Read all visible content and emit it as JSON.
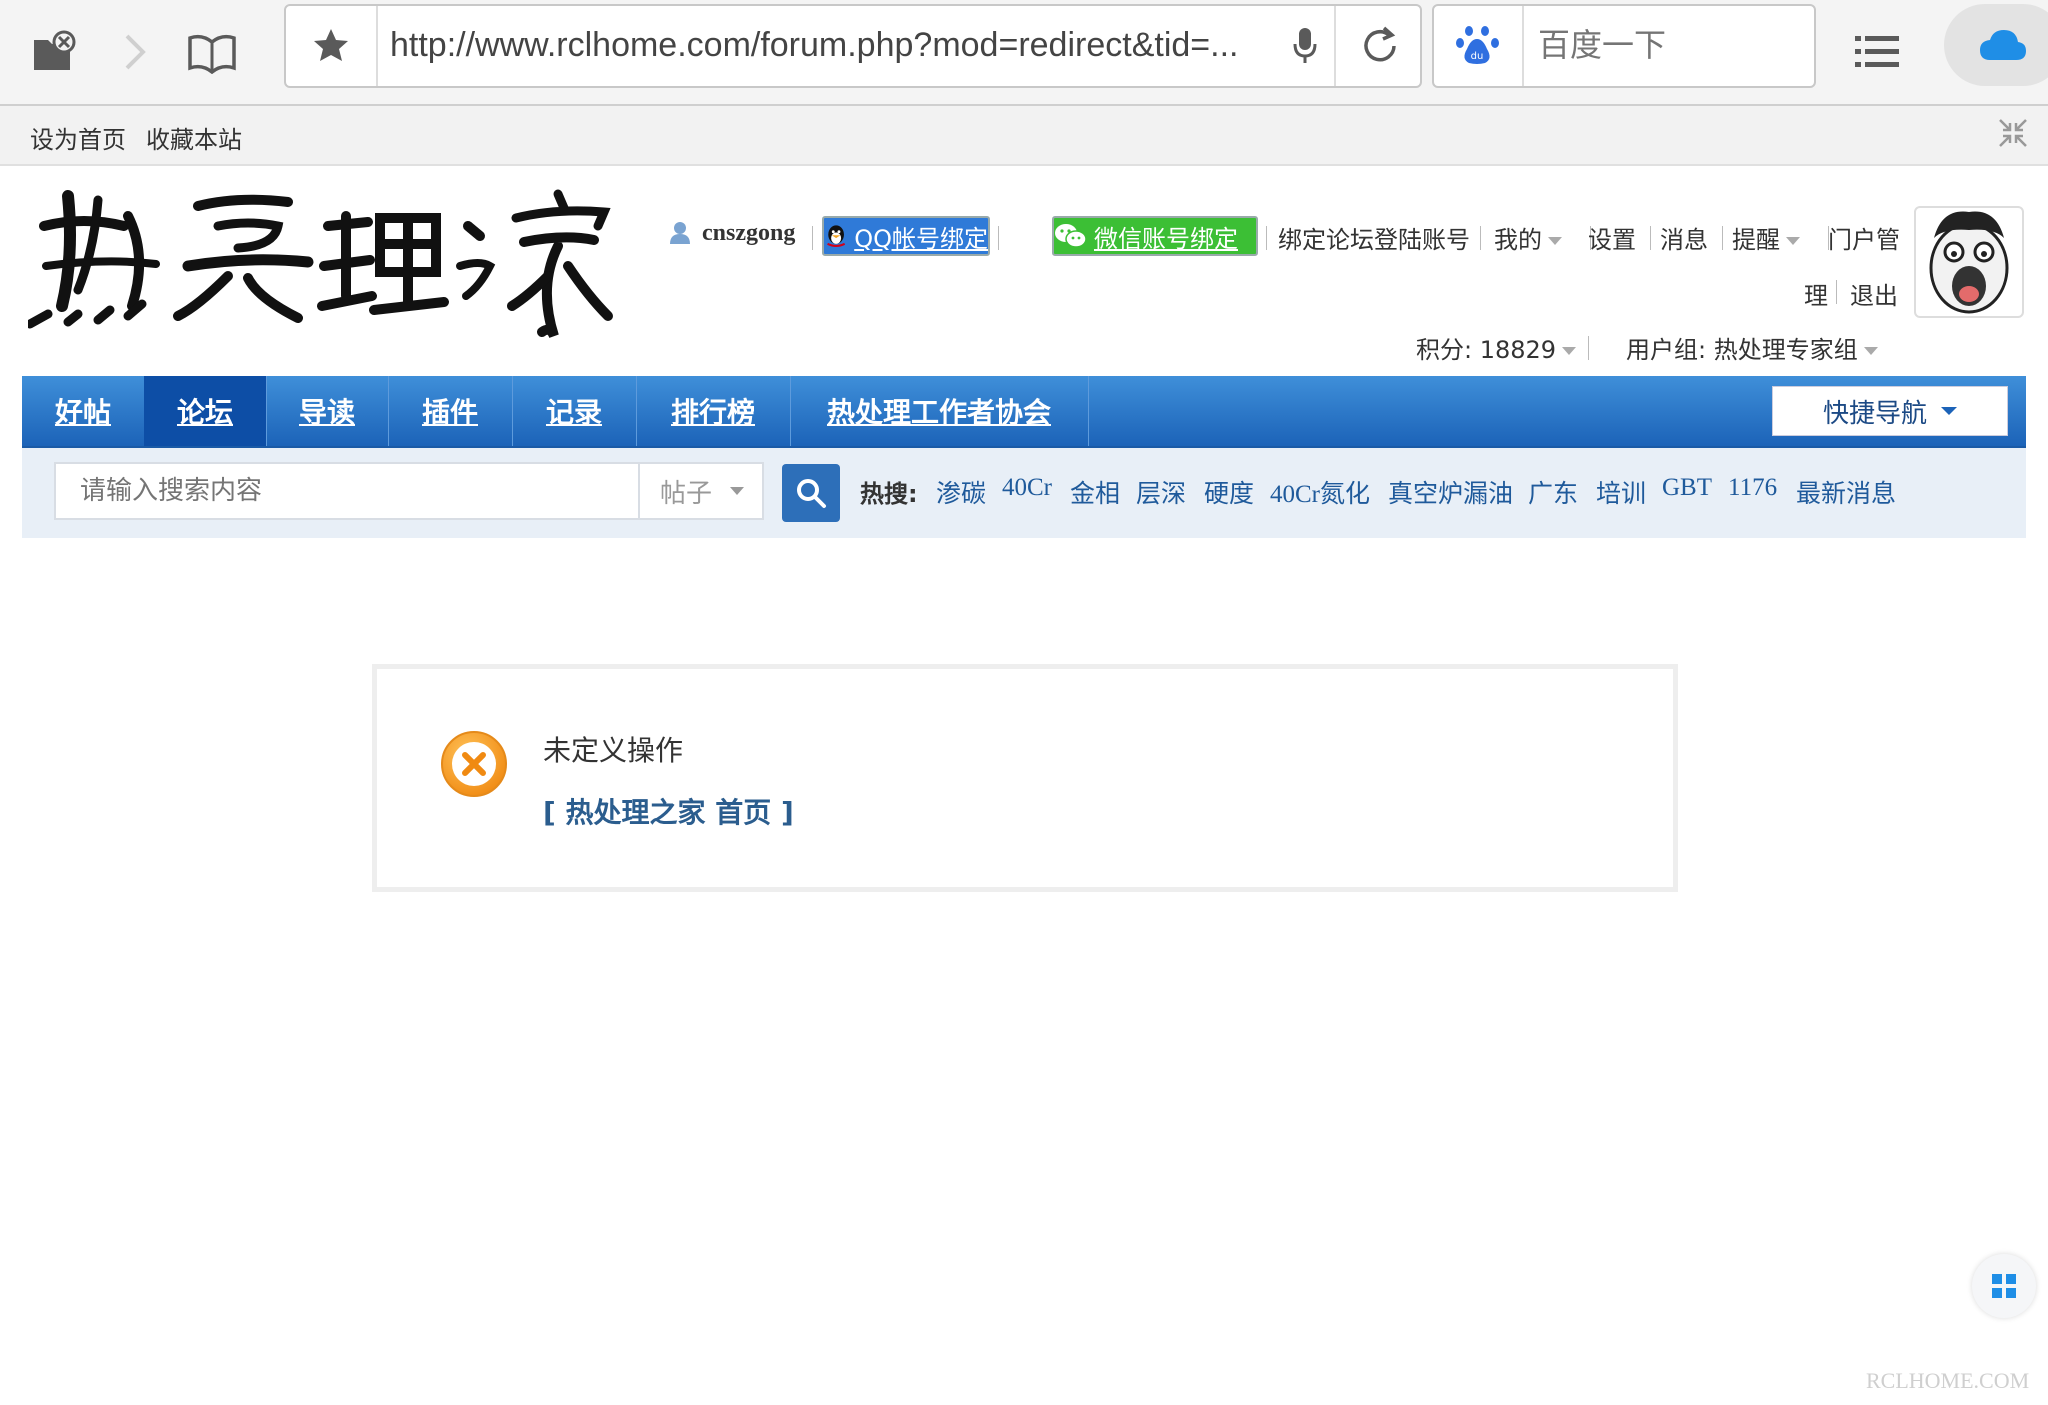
{
  "browser": {
    "url": "http://www.rclhome.com/forum.php?mod=redirect&tid=...",
    "search_placeholder": "百度一下",
    "baidu_badge": "du"
  },
  "site_topbar": {
    "set_home": "设为首页",
    "bookmark": "收藏本站"
  },
  "header": {
    "username": "cnszgong",
    "qq_bind": "QQ帐号绑定",
    "wechat_bind": "微信账号绑定",
    "bind_forum_account": "绑定论坛登陆账号",
    "mine": "我的",
    "settings": "设置",
    "messages": "消息",
    "reminders": "提醒",
    "portal_admin_1": "门户管",
    "portal_admin_2": "理",
    "logout": "退出",
    "points_label": "积分: 18829",
    "user_group": "用户组: 热处理专家组"
  },
  "nav": {
    "items": [
      "好帖",
      "论坛",
      "导读",
      "插件",
      "记录",
      "排行榜",
      "热处理工作者协会"
    ],
    "active_index": 1,
    "quick_nav": "快捷导航"
  },
  "search": {
    "placeholder": "请输入搜索内容",
    "type": "帖子",
    "hot_label": "热搜:",
    "hot_terms": [
      "渗碳",
      "40Cr",
      "金相",
      "层深",
      "硬度",
      "40Cr氮化",
      "真空炉漏油",
      "广东",
      "培训",
      "GBT",
      "1176",
      "最新消息"
    ]
  },
  "message": {
    "title": "未定义操作",
    "home_link": "[ 热处理之家 首页 ]"
  },
  "watermark": "RCLHOME.COM",
  "colors": {
    "nav_blue": "#1c63b8",
    "nav_active": "#0d4ea6",
    "link_blue": "#1f5a9b",
    "error_orange": "#f39b1d"
  }
}
